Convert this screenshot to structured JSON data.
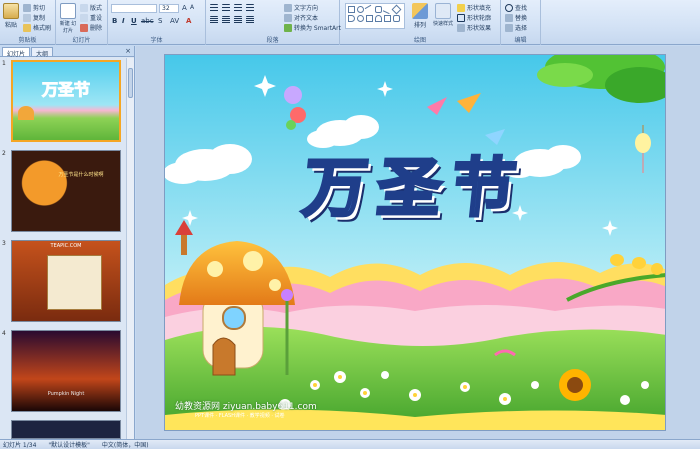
{
  "ribbon": {
    "clipboard": {
      "label": "剪贴板",
      "paste": "粘贴",
      "cut": "剪切",
      "copy": "复制",
      "format_painter": "格式刷"
    },
    "slides": {
      "label": "幻灯片",
      "new_slide": "新建\n幻灯片",
      "layout": "版式",
      "reset": "重设",
      "delete": "删除"
    },
    "font": {
      "label": "字体",
      "font_size": "32",
      "font_name": ""
    },
    "paragraph": {
      "label": "段落",
      "text_direction": "文字方向",
      "align_text": "对齐文本",
      "smartart": "转换为 SmartArt"
    },
    "drawing": {
      "label": "绘图",
      "arrange": "排列",
      "quick_styles": "快速样式",
      "shape_fill": "形状填充",
      "shape_outline": "形状轮廓",
      "shape_effects": "形状效果"
    },
    "editing": {
      "label": "编辑",
      "find": "查找",
      "replace": "替换",
      "select": "选择"
    }
  },
  "left_pane": {
    "tabs": [
      "幻灯片",
      "大纲"
    ],
    "close": "×",
    "slides": [
      {
        "num": "1",
        "title": "万圣节"
      },
      {
        "num": "2",
        "text": "万圣节是什么时候啊"
      },
      {
        "num": "3",
        "text": "TEAPIC.COM"
      },
      {
        "num": "4",
        "text": "Pumpkin Night"
      }
    ]
  },
  "slide": {
    "title": "万圣节",
    "watermark_main": "幼教资源网 ziyuan.baby611.com",
    "watermark_sub": "PPT课件 · FLASH课件 · 教学视频 · 试卷"
  },
  "status": {
    "slide_info": "幻灯片 1/34",
    "theme": "\"默认设计模板\"",
    "language": "中文(简体，中国)"
  },
  "colors": {
    "ribbon_bg": "#d3e2f5",
    "slide_sky": "#5ed3ec",
    "title_fill": "#4a8cde",
    "accent": "#f5a623"
  }
}
